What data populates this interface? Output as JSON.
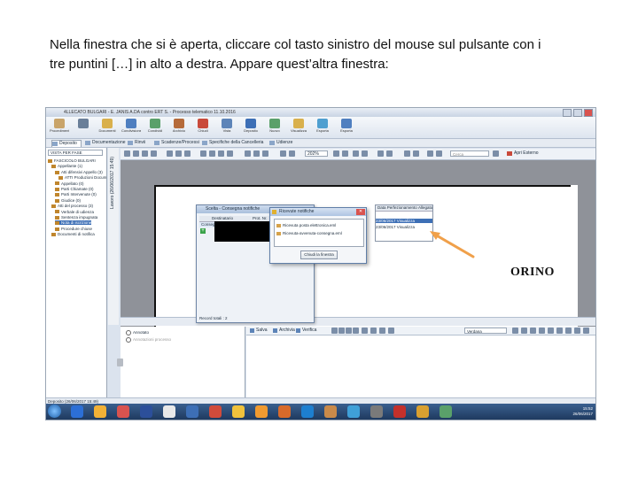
{
  "caption": {
    "line1": "Nella finestra che si è aperta, cliccare col tasto sinistro del mouse sul pulsante con i",
    "line2": "tre puntini […] in alto a destra. Appare quest’altra finestra:"
  },
  "app": {
    "title": "4LLECATO BULGARI - E. JANIS A.DA contro ERT S. - Processo telematico 11.10.2016",
    "ribbon": [
      {
        "label": "Procedimento",
        "icon": "scale-icon",
        "color": "#c9a46a"
      },
      {
        "label": "",
        "icon": "counter-icon",
        "color": "#6a7f99"
      },
      {
        "label": "Documenti",
        "icon": "folder-icon",
        "color": "#d9b04c"
      },
      {
        "label": "Condivisione",
        "icon": "share-icon",
        "color": "#4f7fc0"
      },
      {
        "label": "Condividi",
        "icon": "people-icon",
        "color": "#5aa06a"
      },
      {
        "label": "Archivio",
        "icon": "archive-icon",
        "color": "#b56a3a"
      },
      {
        "label": "Chiudi",
        "icon": "close-doc-icon",
        "color": "#c94a3b"
      },
      {
        "label": "Vista",
        "icon": "view-icon",
        "color": "#5d84b8"
      },
      {
        "label": "Deposito",
        "icon": "deposit-icon",
        "color": "#3d6fb6"
      },
      {
        "label": "Nuovo",
        "icon": "new-icon",
        "color": "#5aa06a"
      },
      {
        "label": "Visualizza",
        "icon": "preview-icon",
        "color": "#d9b04c"
      },
      {
        "label": "Esporta",
        "icon": "export-icon",
        "color": "#4f9fd0"
      },
      {
        "label": "Esporta",
        "icon": "export2-icon",
        "color": "#4f7fc0"
      }
    ],
    "tabs": [
      "Deposito",
      "Documentazione",
      "Rinvii",
      "Scadenze/Processi",
      "Specifiche della Cancelleria",
      "Udienze"
    ],
    "tree": {
      "search": "VISTA PER FASE",
      "items": [
        "FASCICOLO BULGARI",
        "Appellante (1)",
        "Atti difensivi Appello (3)",
        "ATTI Produzioni Docum",
        "Appellato (0)",
        "Parti Chiamate (0)",
        "Parti Intervenute (0)",
        "Giudice (0)",
        "Atti del processo (3)",
        "Verbale di udienza",
        "Sentenza impugnata",
        "Nota di iscrizione",
        "Procedure chiuse",
        "Documenti di notifica"
      ],
      "selected_index": 11
    },
    "side_label": "Lavoro (26/06/2017 15:49)",
    "viewer": {
      "zoom": "202%",
      "search_placeholder": "Cerca",
      "open_external": "Apri Esterno"
    },
    "doc_word": "ORINO",
    "lower_left": {
      "radio1": "Annotato",
      "radio2": "Annotazioni processo"
    },
    "lower_toolbar": [
      "Salva",
      "Archivia",
      "Verifica"
    ],
    "lower_select": "Verdana",
    "statusbar": "Deposito (26/06/2017 15:49)",
    "clock": {
      "time": "15:52",
      "date": "26/06/2017"
    }
  },
  "dialog_back": {
    "title": "Scelta - Consegna notifiche",
    "col1": "Destinatario",
    "col2": "Prot. Nr.",
    "row": "Consegna",
    "footer": "Record totali : 2"
  },
  "dialog_right": {
    "col1": "Data Perfezionamento",
    "col2": "Allegato",
    "rows": [
      "23/06/2017 Visualizza",
      "23/06/2017 Visualizza"
    ]
  },
  "popup": {
    "title": "Ricevute notifiche",
    "items": [
      "Ricevuta posta elettronica.eml",
      "Ricevuta-avvenuta-consegna.eml"
    ],
    "button": "Chiudi la finestra"
  }
}
